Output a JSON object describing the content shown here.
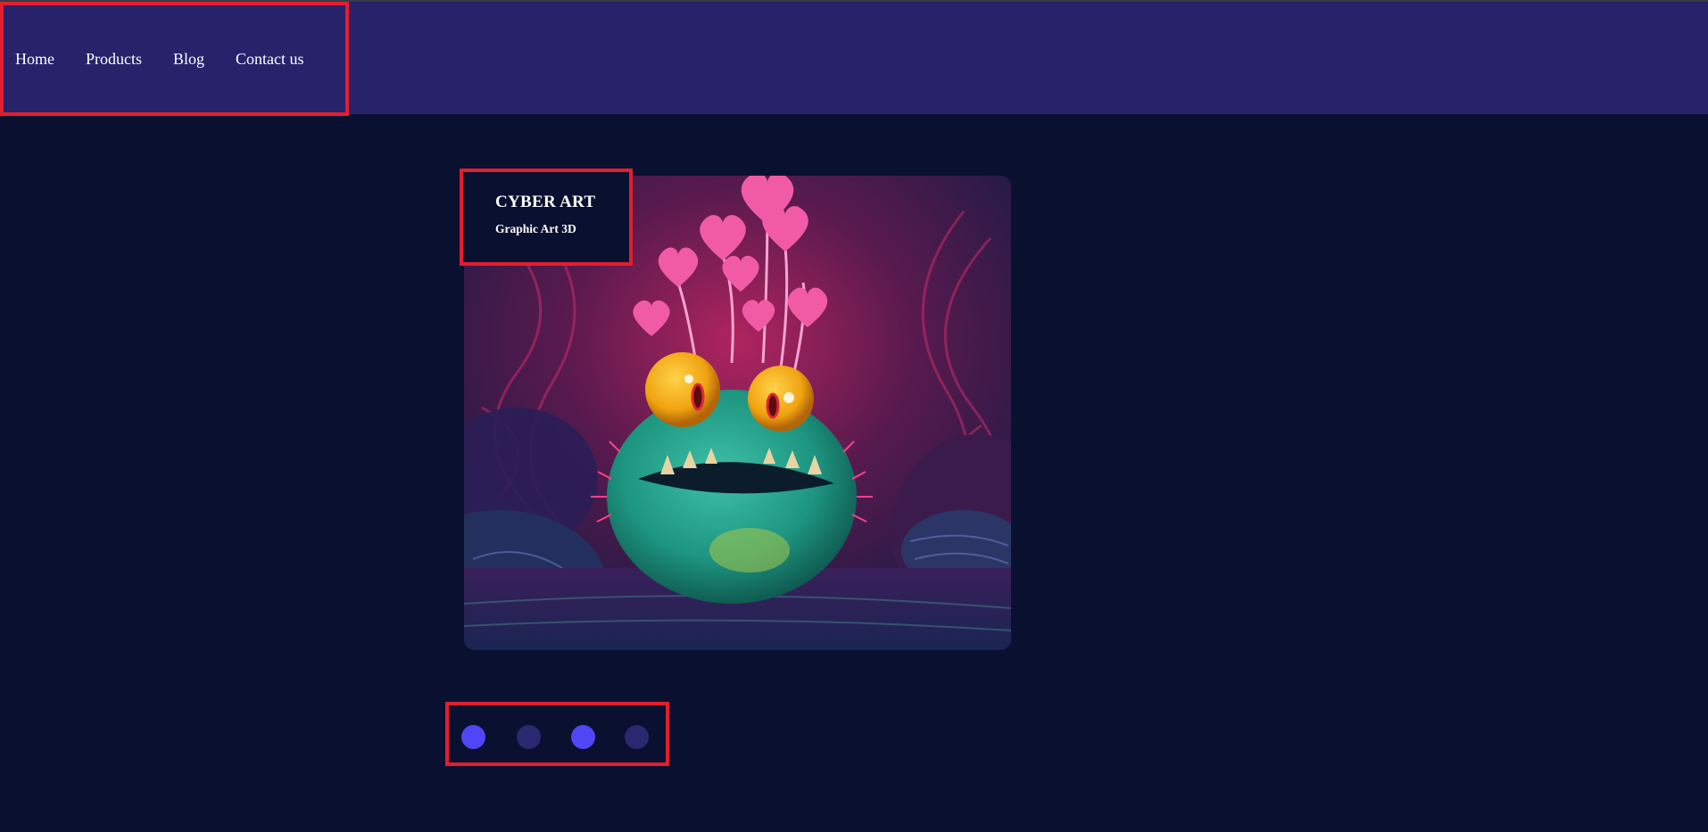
{
  "nav": {
    "items": [
      {
        "label": "Home"
      },
      {
        "label": "Products"
      },
      {
        "label": "Blog"
      },
      {
        "label": "Contact us"
      }
    ]
  },
  "hero": {
    "title": "CYBER ART",
    "subtitle": "Graphic Art 3D",
    "image_alt": "3D render of a teal frog-like monster with yellow eyes and pink heart-shaped plants"
  },
  "carousel": {
    "dots": [
      {
        "state": "active",
        "color": "#5146f5"
      },
      {
        "state": "inactive",
        "color": "#2a2870"
      },
      {
        "state": "active",
        "color": "#5146f5"
      },
      {
        "state": "inactive",
        "color": "#2a2870"
      }
    ]
  },
  "colors": {
    "background": "#0a1030",
    "topbar": "#27226a",
    "highlight_border": "#e31e2e",
    "dot_active": "#5146f5",
    "dot_inactive": "#2a2870"
  }
}
